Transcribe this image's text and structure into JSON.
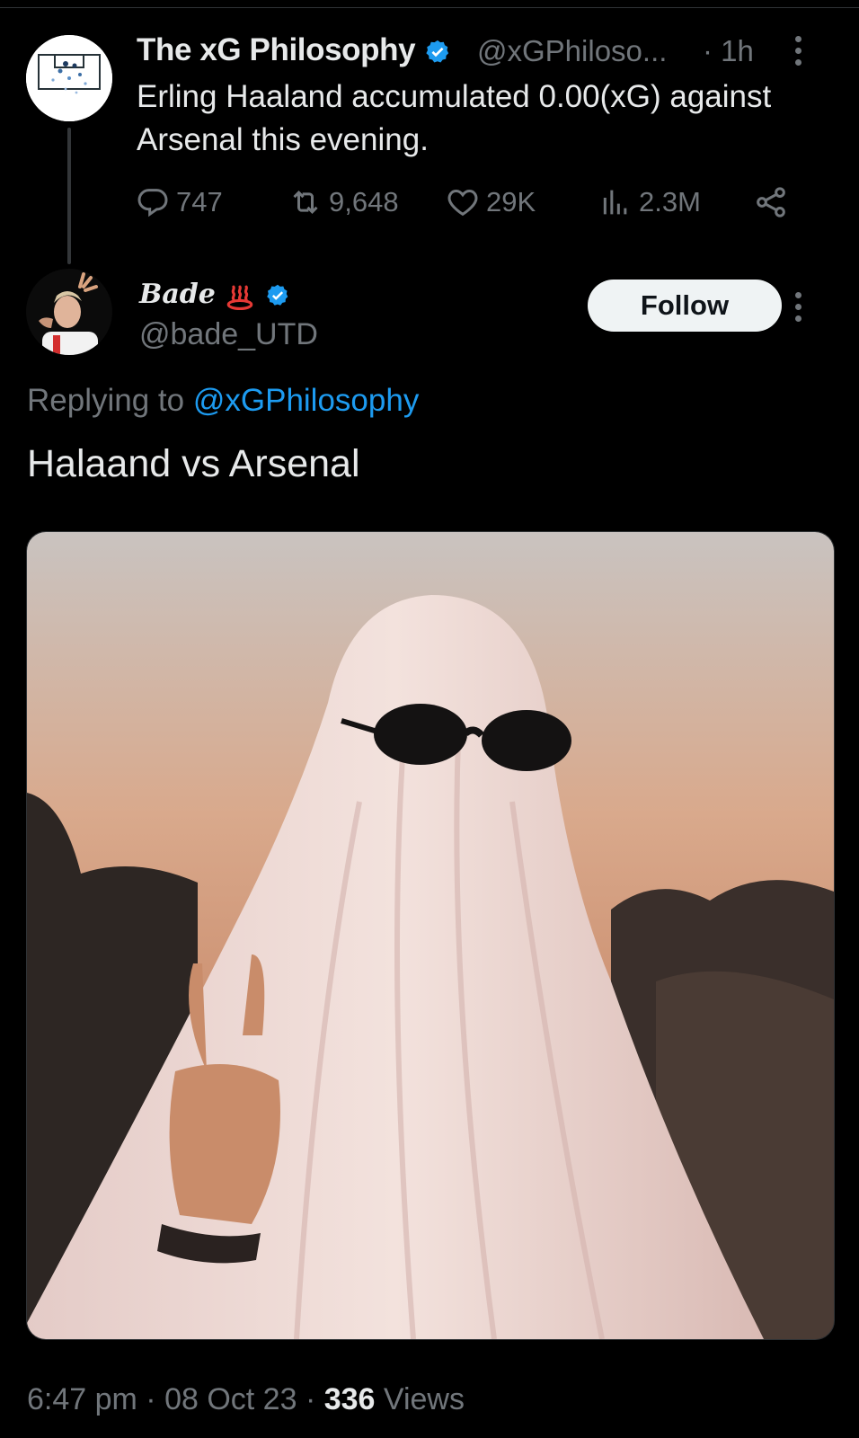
{
  "original_tweet": {
    "display_name": "The xG Philosophy",
    "handle": "@xGPhiloso...",
    "time": "· 1h",
    "text": "Erling Haaland accumulated 0.00(xG) against Arsenal this evening.",
    "replies": "747",
    "reposts": "9,648",
    "likes": "29K",
    "views": "2.3M"
  },
  "reply": {
    "display_name": "Bade",
    "handle": "@bade_UTD",
    "follow_label": "Follow",
    "replying_prefix": "Replying to",
    "replying_handle": "@xGPhilosophy",
    "text": "Halaand vs Arsenal",
    "time": "6:47 pm",
    "date": "08 Oct 23",
    "view_count": "336",
    "views_label": "Views"
  },
  "icons": [
    "verified-badge-icon",
    "more-icon",
    "reply-icon",
    "repost-icon",
    "like-icon",
    "views-icon",
    "share-icon",
    "hot-springs-emoji-icon"
  ],
  "colors": {
    "accent": "#1d9bf0",
    "muted": "#71767b",
    "text": "#e7e9ea",
    "background": "#000000"
  }
}
